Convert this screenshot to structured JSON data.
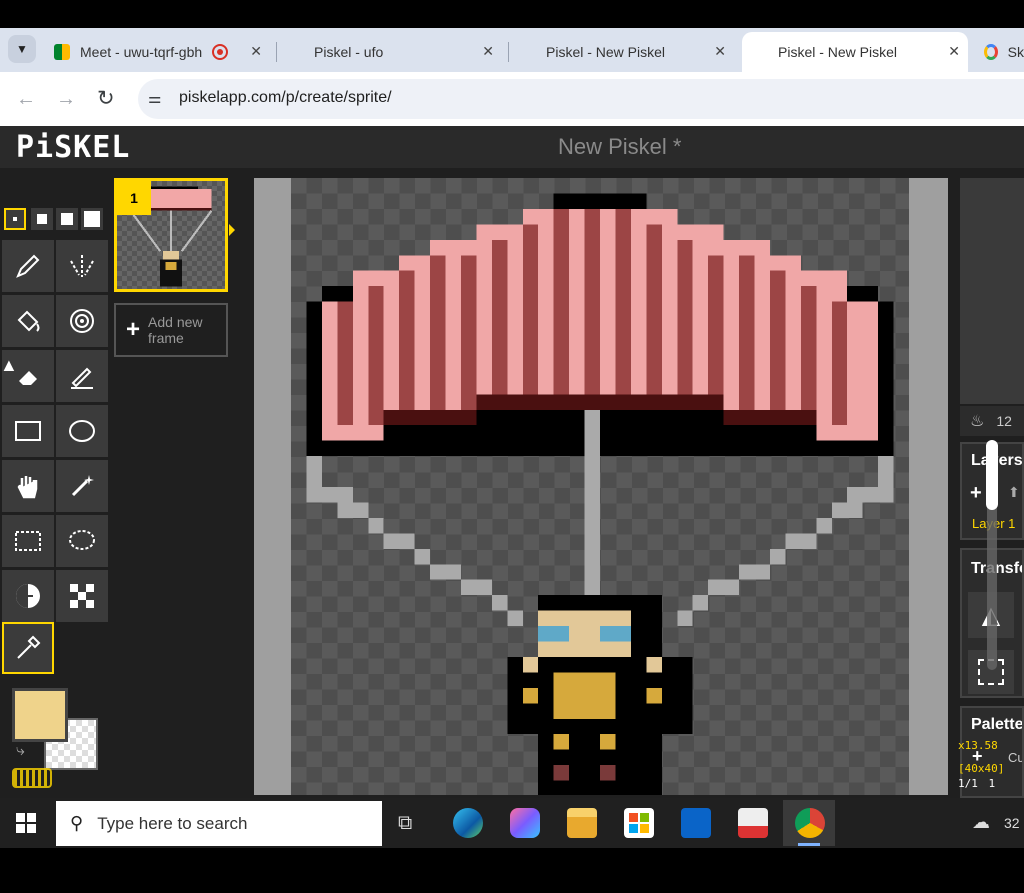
{
  "browser": {
    "tabs": [
      {
        "title": "Meet - uwu-tqrf-gbh"
      },
      {
        "title": "Piskel - ufo"
      },
      {
        "title": "Piskel - New Piskel"
      },
      {
        "title": "Piskel - New Piskel"
      },
      {
        "title": "Sk"
      }
    ],
    "url": "piskelapp.com/p/create/sprite/"
  },
  "app": {
    "logo": "PiSKEL",
    "document_title": "New Piskel *"
  },
  "frames": {
    "frame_number": "1",
    "add_new_frame": "Add new frame"
  },
  "right_panel": {
    "fps": "12",
    "layers_title": "Layers",
    "layer_name": "Layer 1",
    "transform_title": "Transform",
    "palettes_title": "Palettes",
    "palette_extra": "Cu",
    "zoom": "x13.58",
    "size": "[40x40]",
    "frame_count": "1/1",
    "frame_index": "1"
  },
  "colors": {
    "primary": "#efd38b",
    "accent": "#ffd700"
  },
  "taskbar": {
    "search_placeholder": "Type here to search",
    "tray_text": "32"
  }
}
